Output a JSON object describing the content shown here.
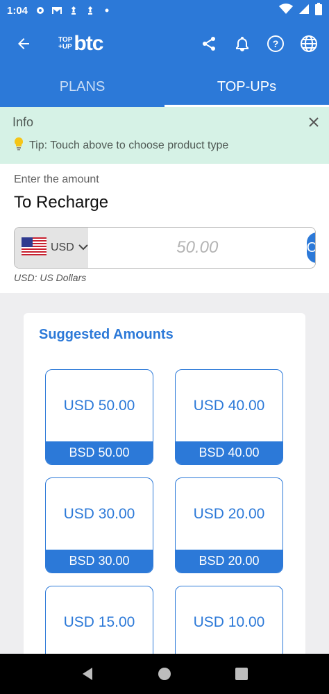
{
  "status": {
    "time": "1:04"
  },
  "appbar": {
    "logo_top": "TOP",
    "logo_up": "+UP",
    "logo_brand": "btc"
  },
  "tabs": [
    {
      "label": "PLANS"
    },
    {
      "label": "TOP-UPs"
    }
  ],
  "info": {
    "title": "Info",
    "tip": "Tip: Touch above to choose product type"
  },
  "amount": {
    "label": "Enter the amount",
    "heading": "To Recharge",
    "currency": "USD",
    "placeholder": "50.00",
    "ok_label": "OK",
    "note": "USD: US Dollars"
  },
  "suggested": {
    "title": "Suggested Amounts",
    "items": [
      {
        "usd": "USD 50.00",
        "bsd": "BSD 50.00"
      },
      {
        "usd": "USD 40.00",
        "bsd": "BSD 40.00"
      },
      {
        "usd": "USD 30.00",
        "bsd": "BSD 30.00"
      },
      {
        "usd": "USD 20.00",
        "bsd": "BSD 20.00"
      },
      {
        "usd": "USD 15.00",
        "bsd": ""
      },
      {
        "usd": "USD 10.00",
        "bsd": ""
      }
    ]
  },
  "colors": {
    "primary": "#2c79d8",
    "info_bg": "#d6f2e6"
  }
}
